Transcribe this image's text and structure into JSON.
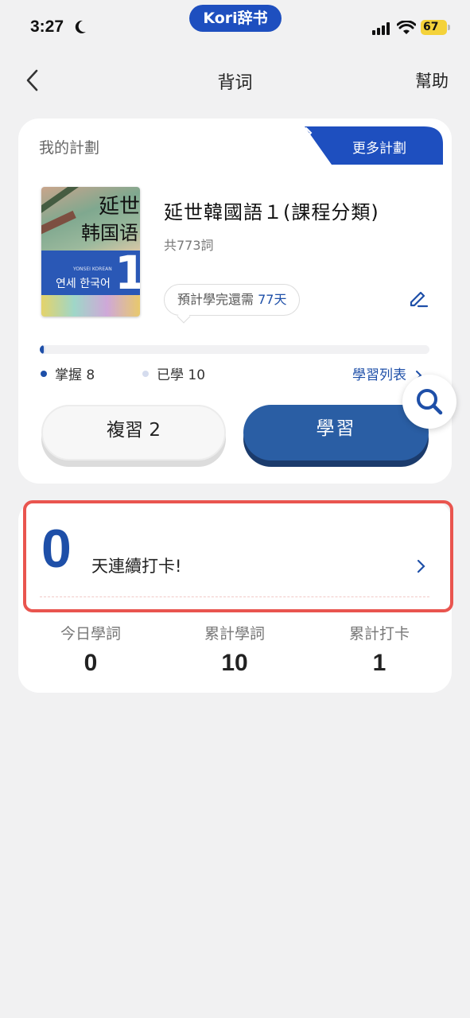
{
  "status_bar": {
    "time": "3:27",
    "app_pill": "Kori辞书",
    "battery": "67"
  },
  "nav": {
    "title": "背词",
    "help": "幫助"
  },
  "plan": {
    "section_label": "我的計劃",
    "more_plans": "更多計劃",
    "book": {
      "title": "延世韓國語１(課程分類)",
      "word_count": "共773詞",
      "cover_title_line1": "延世",
      "cover_title_line2": "韩国语",
      "cover_number": "1",
      "cover_english": "YONSEI KOREAN",
      "cover_korean": "연세 한국어"
    },
    "estimate_prefix": "預計學完還需",
    "estimate_days": "77天",
    "progress": {
      "total": 773,
      "mastered": 8,
      "learned": 10
    },
    "mastered_label": "掌握 8",
    "learned_label": "已學 10",
    "list_link": "學習列表",
    "review_button": "複習 2",
    "study_button": "學習",
    "colors": {
      "primary": "#1e4fa8",
      "study_button": "#2a5ea4",
      "highlight": "#e9554f"
    }
  },
  "streak": {
    "days": "0",
    "label": "天連續打卡!"
  },
  "stats": [
    {
      "label": "今日學詞",
      "value": "0"
    },
    {
      "label": "累計學詞",
      "value": "10"
    },
    {
      "label": "累計打卡",
      "value": "1"
    }
  ]
}
